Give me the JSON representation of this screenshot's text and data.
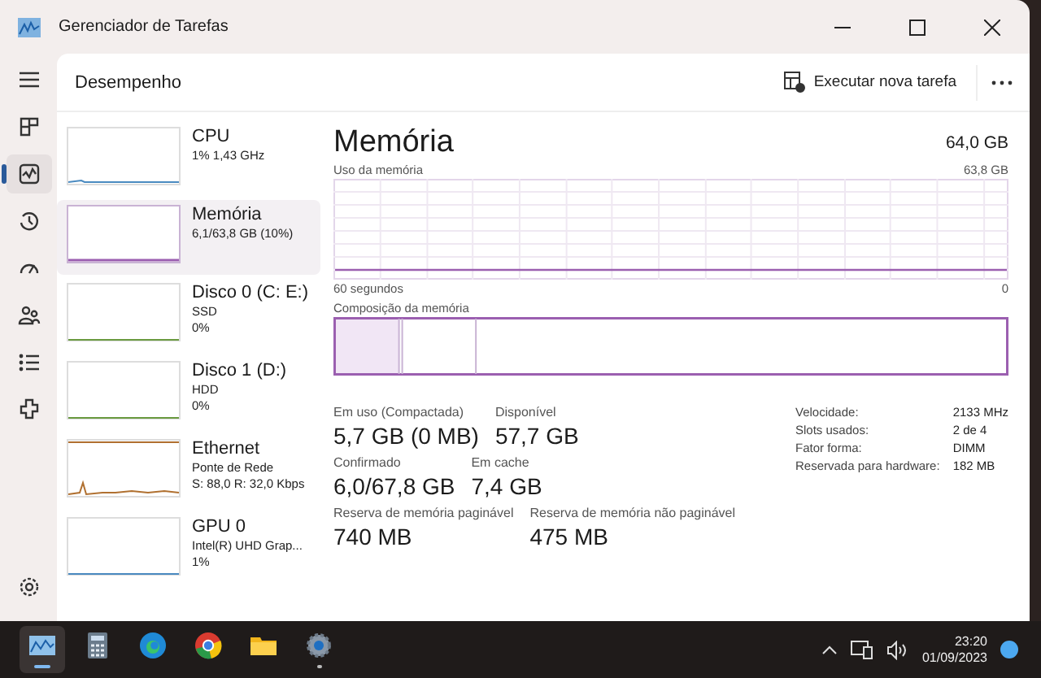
{
  "window": {
    "title": "Gerenciador de Tarefas"
  },
  "nav": [
    {
      "kind": "menu",
      "selected": false
    },
    {
      "kind": "processes",
      "selected": false
    },
    {
      "kind": "performance",
      "selected": true
    },
    {
      "kind": "history",
      "selected": false
    },
    {
      "kind": "startup",
      "selected": false
    },
    {
      "kind": "users",
      "selected": false
    },
    {
      "kind": "details",
      "selected": false
    },
    {
      "kind": "services",
      "selected": false
    }
  ],
  "header": {
    "title": "Desempenho",
    "action": "Executar nova tarefa"
  },
  "devices": [
    {
      "kind": "cpu",
      "name": "CPU",
      "lines": [
        "1%  1,43 GHz"
      ],
      "selected": false
    },
    {
      "kind": "memory",
      "name": "Memória",
      "lines": [
        "6,1/63,8 GB (10%)"
      ],
      "selected": true
    },
    {
      "kind": "disk",
      "name": "Disco 0 (C: E:)",
      "lines": [
        "SSD",
        "0%"
      ],
      "selected": false
    },
    {
      "kind": "disk",
      "name": "Disco 1 (D:)",
      "lines": [
        "HDD",
        "0%"
      ],
      "selected": false
    },
    {
      "kind": "ethernet",
      "name": "Ethernet",
      "lines": [
        "Ponte de Rede",
        "S: 88,0  R: 32,0 Kbps"
      ],
      "selected": false
    },
    {
      "kind": "gpu",
      "name": "GPU 0",
      "lines": [
        "Intel(R) UHD Grap...",
        "1%"
      ],
      "selected": false
    }
  ],
  "main": {
    "title": "Memória",
    "total": "64,0 GB",
    "usage_label": "Uso da memória",
    "usage_max": "63,8 GB",
    "time_label": "60 segundos",
    "zero": "0",
    "composition_label": "Composição da memória",
    "stats": [
      [
        {
          "label": "Em uso (Compactada)",
          "value": "5,7 GB (0 MB)"
        },
        {
          "label": "Disponível",
          "value": "57,7 GB"
        }
      ],
      [
        {
          "label": "Confirmado",
          "value": "6,0/67,8 GB"
        },
        {
          "label": "Em cache",
          "value": "7,4 GB"
        }
      ],
      [
        {
          "label": "Reserva de memória paginável",
          "value": "740 MB"
        },
        {
          "label": "Reserva de memória não paginável",
          "value": "475 MB"
        }
      ]
    ],
    "specs": [
      {
        "label": "Velocidade:",
        "value": "2133 MHz"
      },
      {
        "label": "Slots usados:",
        "value": "2 de 4"
      },
      {
        "label": "Fator forma:",
        "value": "DIMM"
      },
      {
        "label": "Reservada para hardware:",
        "value": "182 MB"
      }
    ]
  },
  "taskbar": {
    "apps": [
      {
        "kind": "taskmgr",
        "active": true,
        "running": true
      },
      {
        "kind": "calculator",
        "active": false,
        "running": false
      },
      {
        "kind": "edge",
        "active": false,
        "running": false
      },
      {
        "kind": "chrome",
        "active": false,
        "running": false
      },
      {
        "kind": "files",
        "active": false,
        "running": false
      },
      {
        "kind": "settings",
        "active": false,
        "running": true
      }
    ],
    "time": "23:20",
    "date": "01/09/2023"
  }
}
